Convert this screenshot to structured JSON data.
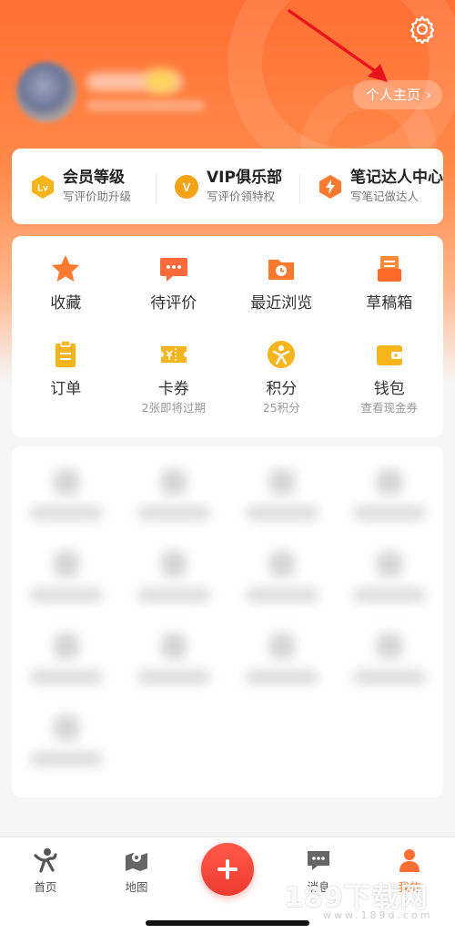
{
  "header": {
    "profile_link_label": "个人主页",
    "profile_link_chevron": "›"
  },
  "membership": [
    {
      "title": "会员等级",
      "sub": "写评价助升级",
      "icon": "lv-badge-icon",
      "icon_text": "Lv"
    },
    {
      "title": "VIP俱乐部",
      "sub": "写评价领特权",
      "icon": "vip-badge-icon",
      "icon_text": "V"
    },
    {
      "title": "笔记达人中心",
      "sub": "写笔记做达人",
      "icon": "bulb-badge-icon",
      "icon_text": ""
    }
  ],
  "grid": {
    "row1": [
      {
        "label": "收藏",
        "sub": "",
        "icon": "star-icon"
      },
      {
        "label": "待评价",
        "sub": "",
        "icon": "comment-icon"
      },
      {
        "label": "最近浏览",
        "sub": "",
        "icon": "history-folder-icon"
      },
      {
        "label": "草稿箱",
        "sub": "",
        "icon": "draft-box-icon"
      }
    ],
    "row2": [
      {
        "label": "订单",
        "sub": "",
        "icon": "order-icon"
      },
      {
        "label": "卡券",
        "sub": "2张即将过期",
        "icon": "coupon-icon"
      },
      {
        "label": "积分",
        "sub": "25积分",
        "icon": "points-icon"
      },
      {
        "label": "钱包",
        "sub": "查看现金券",
        "icon": "wallet-icon"
      }
    ]
  },
  "tabbar": [
    {
      "label": "首页",
      "icon": "home-person-icon",
      "active": false
    },
    {
      "label": "地图",
      "icon": "map-pin-icon",
      "active": false
    },
    {
      "label": "",
      "icon": "plus-icon",
      "active": false
    },
    {
      "label": "消息",
      "icon": "message-icon",
      "active": false
    },
    {
      "label": "我的",
      "icon": "profile-icon",
      "active": true
    }
  ],
  "colors": {
    "brand_orange": "#ff6f33",
    "accent_gold": "#f5b51b",
    "fab_red": "#ef3a2f"
  },
  "watermark": {
    "main": "189下载网",
    "sub": "www.189d.com"
  }
}
